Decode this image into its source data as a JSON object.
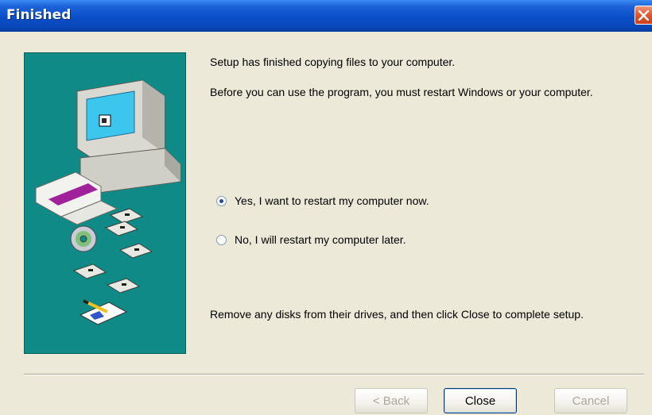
{
  "window": {
    "title": "Finished",
    "close_icon": "close-icon"
  },
  "content": {
    "line1": "Setup has finished copying files to your computer.",
    "line2": "Before you can use the program, you must restart Windows or your computer.",
    "footer_instruction": "Remove any disks from their drives, and then click Close to complete setup."
  },
  "options": {
    "restart_now": {
      "label": "Yes, I want to restart my computer now.",
      "selected": true
    },
    "restart_later": {
      "label": "No, I will restart my computer later.",
      "selected": false
    }
  },
  "buttons": {
    "back": "< Back",
    "close": "Close",
    "cancel": "Cancel"
  },
  "colors": {
    "titlebar": "#0a4fc8",
    "art_panel": "#0f8a86",
    "dialog_bg": "#ece9d8"
  }
}
